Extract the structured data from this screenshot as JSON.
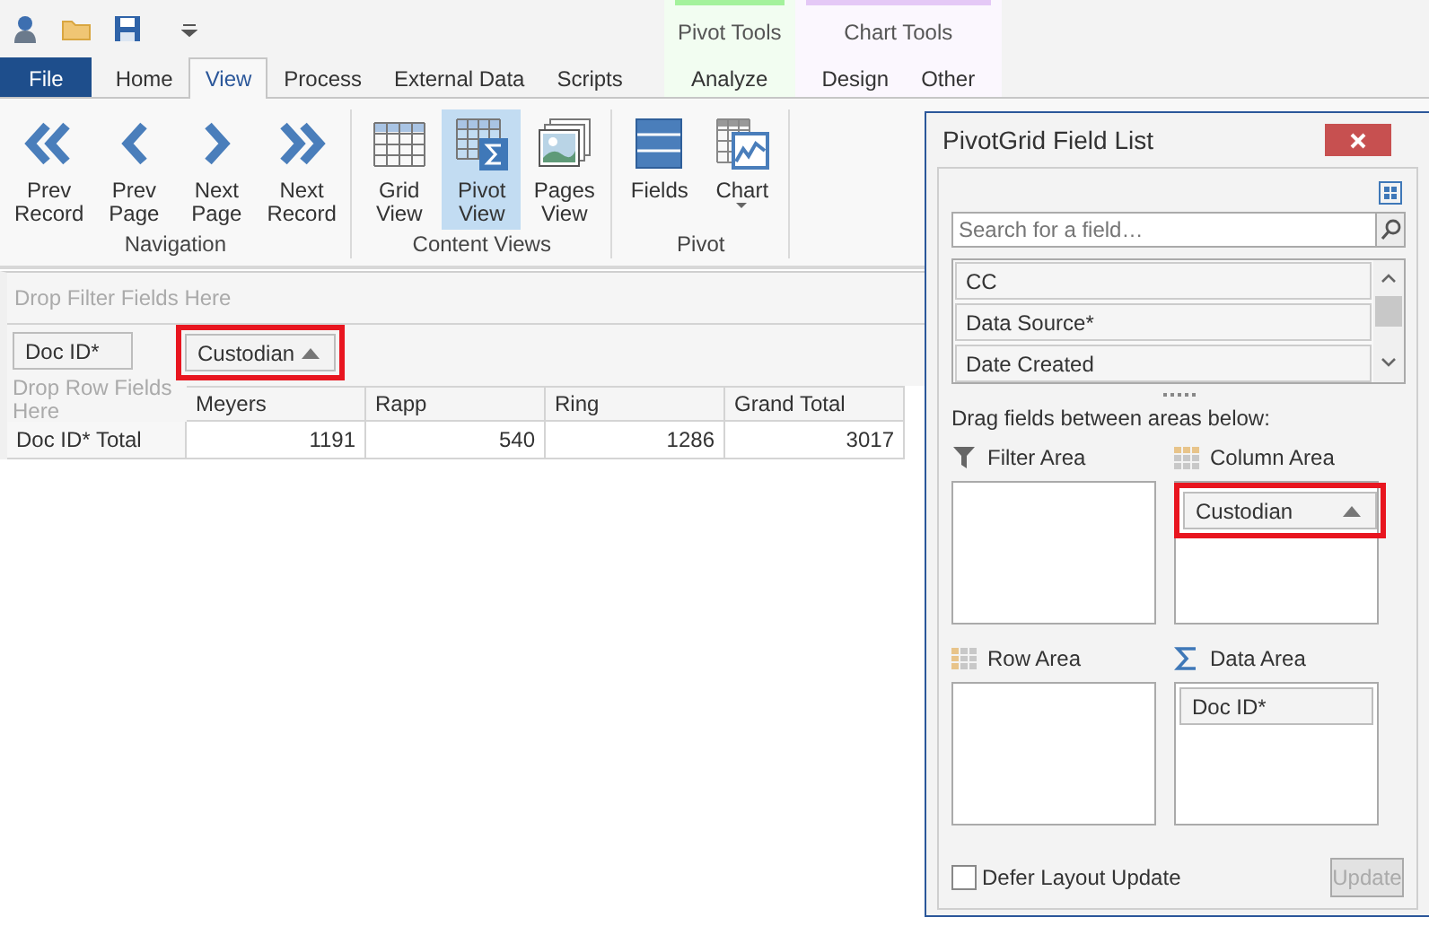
{
  "tabs": [
    {
      "label": "File",
      "kind": "file",
      "selected": false
    },
    {
      "label": "Home",
      "kind": "main",
      "selected": false
    },
    {
      "label": "View",
      "kind": "main",
      "selected": true
    },
    {
      "label": "Process",
      "kind": "main",
      "selected": false
    },
    {
      "label": "External Data",
      "kind": "main",
      "selected": false
    },
    {
      "label": "Scripts",
      "kind": "main",
      "selected": false
    }
  ],
  "context_groups": [
    {
      "label": "Pivot Tools",
      "color": "#a4f29c",
      "tabs": [
        {
          "label": "Analyze",
          "selected": false
        }
      ]
    },
    {
      "label": "Chart Tools",
      "color": "#e4c8f6",
      "tabs": [
        {
          "label": "Design",
          "selected": false
        },
        {
          "label": "Other",
          "selected": false
        }
      ]
    }
  ],
  "ribbon_groups": [
    {
      "label": "Navigation",
      "buttons": [
        {
          "label": "Prev\nRecord",
          "kind": "prev-record",
          "selected": false
        },
        {
          "label": "Prev\nPage",
          "kind": "prev-page",
          "selected": false
        },
        {
          "label": "Next\nPage",
          "kind": "next-page",
          "selected": false
        },
        {
          "label": "Next\nRecord",
          "kind": "next-record",
          "selected": false
        }
      ]
    },
    {
      "label": "Content Views",
      "buttons": [
        {
          "label": "Grid\nView",
          "kind": "grid",
          "selected": false
        },
        {
          "label": "Pivot\nView",
          "kind": "pivot",
          "selected": true
        },
        {
          "label": "Pages\nView",
          "kind": "pages",
          "selected": false
        }
      ]
    },
    {
      "label": "Pivot",
      "buttons": [
        {
          "label": "Fields",
          "kind": "fields",
          "selected": false
        },
        {
          "label": "Chart",
          "kind": "chart",
          "selected": false,
          "dropdown": true
        }
      ]
    }
  ],
  "pivot": {
    "filter_placeholder": "Drop Filter Fields Here",
    "data_field": {
      "label": "Doc ID*",
      "highlighted": false,
      "sorted": false
    },
    "column_field": {
      "label": "Custodian",
      "highlighted": true,
      "sorted": true
    },
    "row_placeholder": "Drop Row Fields Here",
    "columns": [
      "Meyers",
      "Rapp",
      "Ring",
      "Grand Total"
    ],
    "rows": [
      {
        "label": "Doc ID* Total",
        "values": [
          "1191",
          "540",
          "1286",
          "3017"
        ]
      }
    ]
  },
  "field_list": {
    "title": "PivotGrid Field List",
    "search": {
      "placeholder": "Search for a field…"
    },
    "fields": [
      "CC",
      "Data Source*",
      "Date Created"
    ],
    "hint": "Drag fields between areas below:",
    "areas": [
      {
        "kind": "filter",
        "label": "Filter Area"
      },
      {
        "kind": "column",
        "label": "Column Area",
        "fields": [
          {
            "label": "Custodian",
            "highlighted": true,
            "sorted": true
          }
        ]
      },
      {
        "kind": "row",
        "label": "Row Area"
      },
      {
        "kind": "data",
        "label": "Data Area",
        "fields": [
          {
            "label": "Doc ID*",
            "highlighted": false,
            "sorted": false
          }
        ]
      }
    ],
    "defer": {
      "label": "Defer Layout Update",
      "checked": false
    },
    "update_button": {
      "label": "Update",
      "disabled": true
    }
  }
}
